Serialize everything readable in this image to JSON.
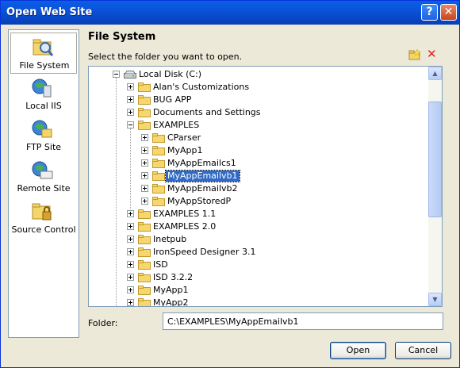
{
  "window": {
    "title": "Open Web Site",
    "help_glyph": "?",
    "close_glyph": "✕"
  },
  "sidebar": {
    "items": [
      {
        "label": "File System",
        "icon": "file-system-icon",
        "selected": true
      },
      {
        "label": "Local IIS",
        "icon": "local-iis-icon",
        "selected": false
      },
      {
        "label": "FTP Site",
        "icon": "ftp-site-icon",
        "selected": false
      },
      {
        "label": "Remote Site",
        "icon": "remote-site-icon",
        "selected": false
      },
      {
        "label": "Source Control",
        "icon": "source-control-icon",
        "selected": false
      }
    ]
  },
  "main": {
    "heading": "File System",
    "instruction": "Select the folder you want to open.",
    "toolbar": {
      "new_folder_icon": "new-folder-icon",
      "delete_icon": "delete-icon"
    }
  },
  "tree": {
    "root": "Local Disk (C:)",
    "nodes": [
      {
        "label": "Alan's Customizations",
        "level": 1,
        "expanded": false
      },
      {
        "label": "BUG APP",
        "level": 1,
        "expanded": false
      },
      {
        "label": "Documents and Settings",
        "level": 1,
        "expanded": false
      },
      {
        "label": "EXAMPLES",
        "level": 1,
        "expanded": true
      },
      {
        "label": "CParser",
        "level": 2,
        "expanded": false
      },
      {
        "label": "MyApp1",
        "level": 2,
        "expanded": false
      },
      {
        "label": "MyAppEmailcs1",
        "level": 2,
        "expanded": false
      },
      {
        "label": "MyAppEmailvb1",
        "level": 2,
        "expanded": false,
        "selected": true
      },
      {
        "label": "MyAppEmailvb2",
        "level": 2,
        "expanded": false
      },
      {
        "label": "MyAppStoredP",
        "level": 2,
        "expanded": false
      },
      {
        "label": "EXAMPLES 1.1",
        "level": 1,
        "expanded": false
      },
      {
        "label": "EXAMPLES 2.0",
        "level": 1,
        "expanded": false
      },
      {
        "label": "Inetpub",
        "level": 1,
        "expanded": false
      },
      {
        "label": "IronSpeed Designer 3.1",
        "level": 1,
        "expanded": false
      },
      {
        "label": "ISD",
        "level": 1,
        "expanded": false
      },
      {
        "label": "ISD 3.2.2",
        "level": 1,
        "expanded": false
      },
      {
        "label": "MyApp1",
        "level": 1,
        "expanded": false
      },
      {
        "label": "MyApp2",
        "level": 1,
        "expanded": false
      }
    ]
  },
  "folder": {
    "label": "Folder:",
    "value": "C:\\EXAMPLES\\MyAppEmailvb1"
  },
  "buttons": {
    "open": "Open",
    "cancel": "Cancel"
  },
  "colors": {
    "title_bar": "#0a53d8",
    "selection": "#316ac5",
    "folder_yellow": "#f5d76e"
  }
}
